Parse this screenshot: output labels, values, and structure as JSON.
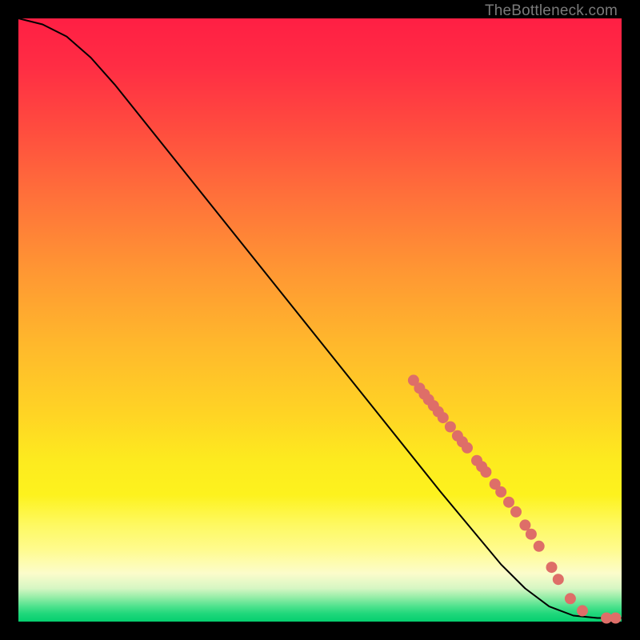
{
  "watermark": "TheBottleneck.com",
  "chart_data": {
    "type": "line",
    "title": "",
    "xlabel": "",
    "ylabel": "",
    "xlim": [
      0,
      100
    ],
    "ylim": [
      0,
      100
    ],
    "curve": [
      {
        "x": 0,
        "y": 100
      },
      {
        "x": 4,
        "y": 99
      },
      {
        "x": 8,
        "y": 97
      },
      {
        "x": 12,
        "y": 93.5
      },
      {
        "x": 16,
        "y": 89
      },
      {
        "x": 20,
        "y": 84
      },
      {
        "x": 30,
        "y": 71.5
      },
      {
        "x": 40,
        "y": 59
      },
      {
        "x": 50,
        "y": 46.5
      },
      {
        "x": 60,
        "y": 34
      },
      {
        "x": 70,
        "y": 21.5
      },
      {
        "x": 80,
        "y": 9.5
      },
      {
        "x": 84,
        "y": 5.5
      },
      {
        "x": 88,
        "y": 2.5
      },
      {
        "x": 92,
        "y": 1.0
      },
      {
        "x": 96,
        "y": 0.6
      },
      {
        "x": 100,
        "y": 0.6
      }
    ],
    "highlight_points": [
      {
        "x": 65.5,
        "y": 40.0
      },
      {
        "x": 66.5,
        "y": 38.7
      },
      {
        "x": 67.3,
        "y": 37.7
      },
      {
        "x": 68.0,
        "y": 36.8
      },
      {
        "x": 68.8,
        "y": 35.8
      },
      {
        "x": 69.6,
        "y": 34.8
      },
      {
        "x": 70.4,
        "y": 33.8
      },
      {
        "x": 71.6,
        "y": 32.3
      },
      {
        "x": 72.8,
        "y": 30.8
      },
      {
        "x": 73.6,
        "y": 29.8
      },
      {
        "x": 74.4,
        "y": 28.8
      },
      {
        "x": 76.0,
        "y": 26.7
      },
      {
        "x": 76.8,
        "y": 25.7
      },
      {
        "x": 77.5,
        "y": 24.8
      },
      {
        "x": 79.0,
        "y": 22.8
      },
      {
        "x": 80.0,
        "y": 21.5
      },
      {
        "x": 81.3,
        "y": 19.8
      },
      {
        "x": 82.5,
        "y": 18.2
      },
      {
        "x": 84.0,
        "y": 16.0
      },
      {
        "x": 85.0,
        "y": 14.5
      },
      {
        "x": 86.3,
        "y": 12.5
      },
      {
        "x": 88.4,
        "y": 9.0
      },
      {
        "x": 89.5,
        "y": 7.0
      },
      {
        "x": 91.5,
        "y": 3.8
      },
      {
        "x": 93.5,
        "y": 1.8
      },
      {
        "x": 97.5,
        "y": 0.6
      },
      {
        "x": 99.0,
        "y": 0.6
      }
    ],
    "highlight_color": "#de6e68",
    "curve_color": "#000000"
  }
}
